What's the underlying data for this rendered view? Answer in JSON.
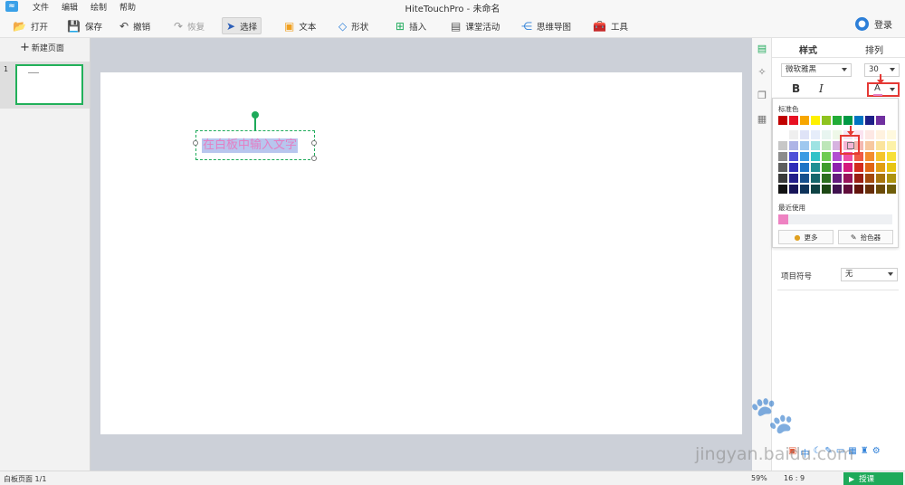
{
  "menubar": {
    "items": [
      "文件",
      "编辑",
      "绘制",
      "帮助"
    ],
    "title": "HiteTouchPro - 未命名"
  },
  "toolbar": {
    "open": "打开",
    "save": "保存",
    "undo": "撤销",
    "redo": "恢复",
    "select": "选择",
    "text": "文本",
    "shape": "形状",
    "insert": "插入",
    "activity": "课堂活动",
    "mindmap": "思维导图",
    "tools": "工具",
    "login": "登录"
  },
  "leftpanel": {
    "new_page": "新建页面",
    "page_number": "1"
  },
  "canvas": {
    "textbox_text": "在白板中输入文字",
    "text_color": "#e47ec3"
  },
  "rpanel": {
    "tab_style": "样式",
    "tab_arrange": "排列",
    "font_family": "微软雅黑",
    "font_size": "30",
    "bold": "B",
    "italic": "I",
    "color_letter": "A",
    "bullet_label": "项目符号",
    "bullet_value": "无"
  },
  "color_popup": {
    "standard_label": "标准色",
    "recent_label": "最近使用",
    "more_label": "更多",
    "picker_label": "拾色器",
    "selected_color": "#f5b5d5",
    "recent_color": "#ee82c2",
    "standard_colors": [
      "#c00000",
      "#e81123",
      "#f7a600",
      "#fff100",
      "#8fc31f",
      "#22ac38",
      "#009944",
      "#0075c2",
      "#1d2088",
      "#7030a0"
    ],
    "main_colors": [
      [
        "#ffffff",
        "#efefef",
        "#dfe3f7",
        "#e6edfa",
        "#e8f5f0",
        "#eef8e8",
        "#f3e6f5",
        "#fbe3f0",
        "#fde8e4",
        "#fff2df",
        "#fff9de"
      ],
      [
        "#c7c7c7",
        "#aeb4e6",
        "#9fc8ef",
        "#9ee3e3",
        "#bde6b8",
        "#d6b3e0",
        "#f5b5d5",
        "#f4b7b0",
        "#f7c89f",
        "#fbe49c",
        "#fdf2a8"
      ],
      [
        "#8c8c8c",
        "#4e4fd8",
        "#3c9be3",
        "#32c2c8",
        "#6ecb52",
        "#b14fd1",
        "#ee4fa6",
        "#ef5a44",
        "#f38d2d",
        "#f5c52c",
        "#f7e038"
      ],
      [
        "#5e5e5e",
        "#2e2bb8",
        "#1e74c6",
        "#1f8f94",
        "#3f9d2c",
        "#8d22ae",
        "#d4187c",
        "#d32b1c",
        "#e06514",
        "#e19e12",
        "#e7c514"
      ],
      [
        "#3a3a3a",
        "#221d8a",
        "#164f8c",
        "#15666b",
        "#2d6f1f",
        "#641b7d",
        "#97135a",
        "#991e13",
        "#a2490e",
        "#a7750d",
        "#ad930f"
      ],
      [
        "#121212",
        "#171459",
        "#0e335a",
        "#0e4244",
        "#1c4713",
        "#3f114f",
        "#600c3a",
        "#62140c",
        "#672e09",
        "#6b4b08",
        "#6f5e0a"
      ]
    ]
  },
  "status": {
    "page_info": "白板页面 1/1",
    "zoom": "59%",
    "ratio": "16 : 9",
    "start": "授课"
  },
  "watermark": {
    "url": "jingyan.baidu.com"
  }
}
